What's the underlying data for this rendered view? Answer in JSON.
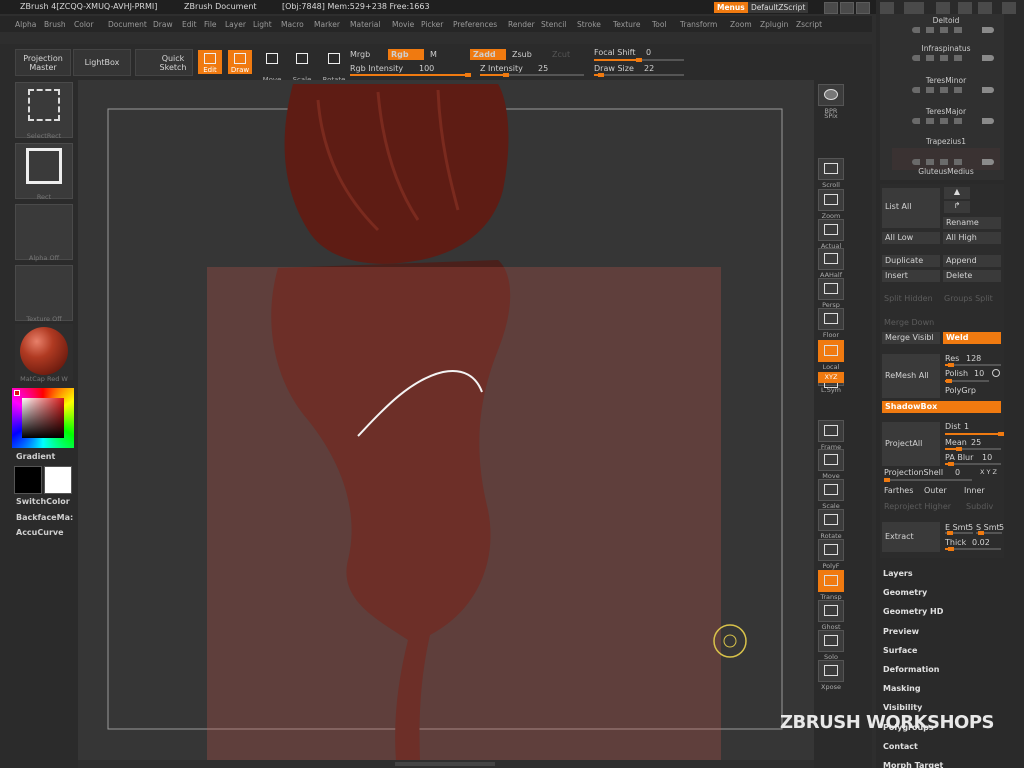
{
  "titlebar": {
    "app": "ZBrush 4[ZCQQ-XMUQ-AVHJ-PRMI]",
    "doc": "ZBrush Document",
    "stats": "[Obj:7848] Mem:529+238 Free:1663",
    "menus_button": "Menus",
    "script_button": "DefaultZScript"
  },
  "menubar": {
    "items": [
      "Alpha",
      "Brush",
      "Color",
      "Document",
      "Draw",
      "Edit",
      "File",
      "Layer",
      "Light",
      "Macro",
      "Marker",
      "Material",
      "Movie",
      "Picker",
      "Preferences",
      "Render",
      "Stencil",
      "Stroke",
      "Texture",
      "Tool",
      "Transform",
      "Zoom",
      "Zplugin",
      "Zscript"
    ]
  },
  "shelf": {
    "projection_master": "Projection Master",
    "lightbox": "LightBox",
    "quick_sketch": "Quick Sketch",
    "tools": [
      {
        "label": "Edit",
        "active": true
      },
      {
        "label": "Draw",
        "active": true
      },
      {
        "label": "Move",
        "active": false
      },
      {
        "label": "Scale",
        "active": false
      },
      {
        "label": "Rotate",
        "active": false
      }
    ],
    "mrgb": "Mrgb",
    "rgb": "Rgb",
    "m": "M",
    "rgb_intensity_label": "Rgb Intensity",
    "rgb_intensity_value": "100",
    "rgb_intensity": 1.0,
    "zadd": "Zadd",
    "zsub": "Zsub",
    "zcut": "Zcut",
    "z_intensity_label": "Z Intensity",
    "z_intensity_value": "25",
    "z_intensity": 0.25,
    "focal_shift_label": "Focal Shift",
    "focal_shift_value": "0",
    "focal_shift": 0.5,
    "draw_size_label": "Draw Size",
    "draw_size_value": "22",
    "draw_size": 0.08
  },
  "left_tray": {
    "thumbs": [
      "SelectRect",
      "Rect",
      "Alpha Off",
      "Texture Off",
      "MatCap Red W"
    ],
    "gradient": "Gradient",
    "switch_color": "SwitchColor",
    "backface_mask": "BackfaceMa:",
    "accucurve": "AccuCurve"
  },
  "right_tray": {
    "buttons": [
      {
        "label": "BPR",
        "active": false
      },
      {
        "label": "SPix",
        "active": false
      },
      {
        "label": "Scroll",
        "active": false
      },
      {
        "label": "Zoom",
        "active": false
      },
      {
        "label": "Actual",
        "active": false
      },
      {
        "label": "AAHalf",
        "active": false
      },
      {
        "label": "Persp",
        "active": false
      },
      {
        "label": "Floor",
        "active": false
      },
      {
        "label": "Local",
        "active": true
      },
      {
        "label": "L.Sym",
        "active": false
      },
      {
        "label": "XYZ",
        "active": true
      },
      {
        "label": "Frame",
        "active": false
      },
      {
        "label": "Move",
        "active": false
      },
      {
        "label": "Scale",
        "active": false
      },
      {
        "label": "Rotate",
        "active": false
      },
      {
        "label": "PolyF",
        "active": false
      },
      {
        "label": "Transp",
        "active": true
      },
      {
        "label": "Ghost",
        "active": false
      },
      {
        "label": "Solo",
        "active": false
      },
      {
        "label": "Xpose",
        "active": false
      }
    ]
  },
  "subtools": {
    "items": [
      "Deltoid",
      "Infraspinatus",
      "TeresMinor",
      "TeresMajor",
      "Trapezius1",
      "GluteusMedius"
    ]
  },
  "tool_panel": {
    "list_all": "List All",
    "rename": "Rename",
    "all_low": "All Low",
    "all_high": "All High",
    "duplicate": "Duplicate",
    "append": "Append",
    "insert": "Insert",
    "delete": "Delete",
    "split_hidden": "Split Hidden",
    "groups_split": "Groups Split",
    "merge_down": "Merge Down",
    "merge_visible": "Merge Visibl",
    "weld": "Weld",
    "remesh_all": "ReMesh All",
    "res_label": "Res",
    "res_value": "128",
    "res": 0.1,
    "polish_label": "Polish",
    "polish_value": "10",
    "polish": 0.1,
    "polygrp": "PolyGrp",
    "shadowbox": "ShadowBox",
    "project_all": "ProjectAll",
    "dist_label": "Dist",
    "dist_value": "1",
    "dist": 1.0,
    "mean_label": "Mean",
    "mean_value": "25",
    "mean": 0.25,
    "pa_blur_label": "PA Blur",
    "pa_blur_value": "10",
    "pa_blur": 0.1,
    "projection_shell_label": "ProjectionShell",
    "projection_shell_value": "0",
    "projection_shell": 0.0,
    "xyz_small": "X Y Z",
    "farthest": "Farthes",
    "outer": "Outer",
    "inner": "Inner",
    "reproject_higher": "Reproject Higher",
    "subdiv": "Subdiv",
    "extract": "Extract",
    "e_smt_label": "E Smt",
    "e_smt_value": "5",
    "s_smt_label": "S Smt",
    "s_smt_value": "5",
    "thick_label": "Thick",
    "thick_value": "0.02",
    "thick": 0.1,
    "sections": [
      "Layers",
      "Geometry",
      "Geometry HD",
      "Preview",
      "Surface",
      "Deformation",
      "Masking",
      "Visibility",
      "Polygroups",
      "Contact",
      "Morph Target"
    ]
  },
  "watermark": "ZBRUSH WORKSHOPS",
  "colors": {
    "accent": "#f07a10",
    "bg": "#2e2e2e",
    "canvas": "#363636"
  }
}
